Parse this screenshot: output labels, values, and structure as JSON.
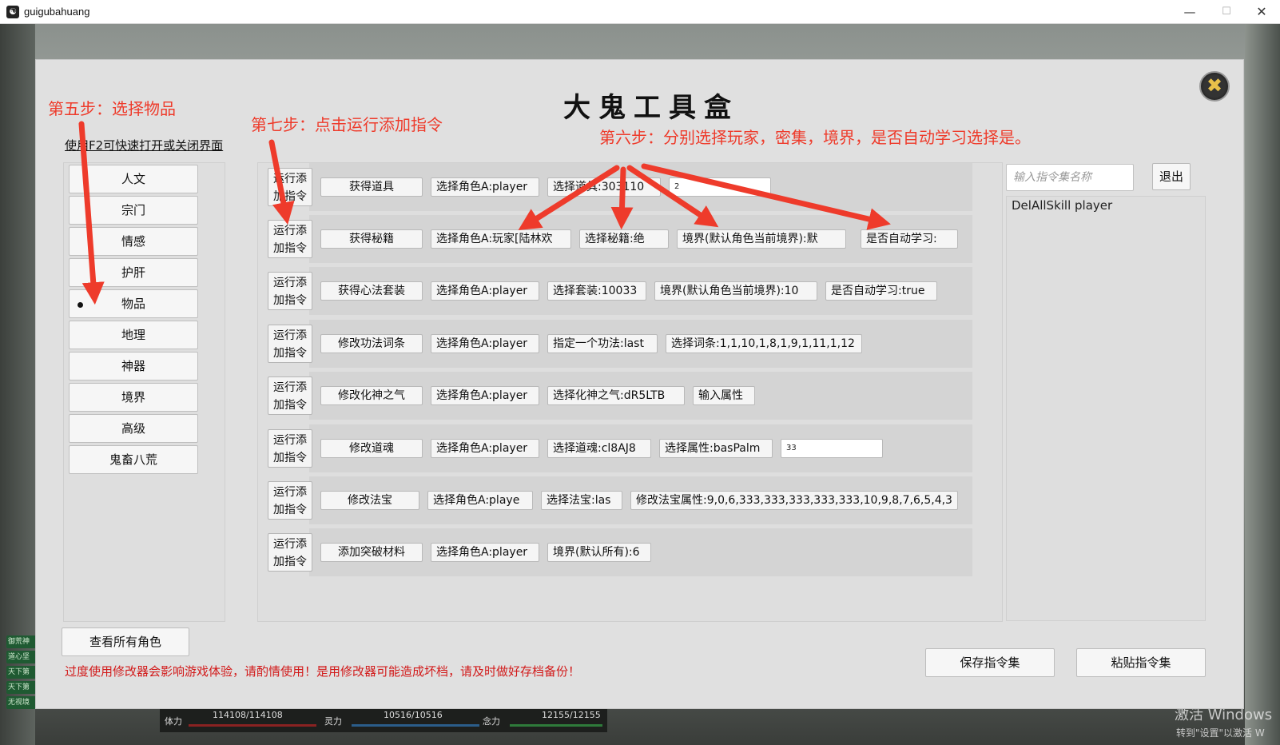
{
  "window": {
    "title": "guigubahuang",
    "minimize": "—",
    "maximize": "☐",
    "close": "✕"
  },
  "panel": {
    "title": "大鬼工具盒",
    "close_icon": "✖",
    "hint": "使用F2可快速打开或关闭界面"
  },
  "categories": [
    {
      "label": "人文",
      "selected": false
    },
    {
      "label": "宗门",
      "selected": false
    },
    {
      "label": "情感",
      "selected": false
    },
    {
      "label": "护肝",
      "selected": false
    },
    {
      "label": "物品",
      "selected": true
    },
    {
      "label": "地理",
      "selected": false
    },
    {
      "label": "神器",
      "selected": false
    },
    {
      "label": "境界",
      "selected": false
    },
    {
      "label": "高级",
      "selected": false
    },
    {
      "label": "鬼畜八荒",
      "selected": false
    }
  ],
  "run_button": {
    "line1": "运行添",
    "line2": "加指令"
  },
  "commands": [
    {
      "name": "获得道具",
      "params": [
        "选择角色A:player",
        "选择道具:303110"
      ],
      "input": "2"
    },
    {
      "name": "获得秘籍",
      "params": [
        "选择角色A:玩家[陆林欢",
        "选择秘籍:绝",
        "境界(默认角色当前境界):默",
        "是否自动学习:"
      ]
    },
    {
      "name": "获得心法套装",
      "params": [
        "选择角色A:player",
        "选择套装:10033",
        "境界(默认角色当前境界):10",
        "是否自动学习:true"
      ]
    },
    {
      "name": "修改功法词条",
      "params": [
        "选择角色A:player",
        "指定一个功法:last",
        "选择词条:1,1,10,1,8,1,9,1,11,1,12"
      ]
    },
    {
      "name": "修改化神之气",
      "params": [
        "选择角色A:player",
        "选择化神之气:dR5LTB",
        "输入属性"
      ]
    },
    {
      "name": "修改道魂",
      "params": [
        "选择角色A:player",
        "选择道魂:cl8AJ8",
        "选择属性:basPalm"
      ],
      "input": "33"
    },
    {
      "name": "修改法宝",
      "params": [
        "选择角色A:playe",
        "选择法宝:las",
        "修改法宝属性:9,0,6,333,333,333,333,333,10,9,8,7,6,5,4,3"
      ]
    },
    {
      "name": "添加突破材料",
      "params": [
        "选择角色A:player",
        "境界(默认所有):6"
      ]
    }
  ],
  "command_set": {
    "placeholder": "输入指令集名称",
    "exit_label": "退出",
    "entries": [
      "DelAllSkill player"
    ]
  },
  "footer": {
    "view_all": "查看所有角色",
    "warning": "过度使用修改器会影响游戏体验，请酌情使用！是用修改器可能造成坏档，请及时做好存档备份！",
    "save": "保存指令集",
    "paste": "粘贴指令集"
  },
  "annotations": {
    "step5": "第五步：选择物品",
    "step7": "第七步：点击运行添加指令",
    "step6": "第六步：分别选择玩家，密集，境界，是否自动学习选择是。",
    "color": "#ee3b2b"
  },
  "hud": {
    "hp_label": "体力",
    "hp": "114108/114108",
    "mp_label": "灵力",
    "mp": "10516/10516",
    "mind_label": "念力",
    "mind": "12155/12155"
  },
  "side_tags": [
    "御荒神",
    "道心坚",
    "天下第",
    "天下第",
    "无视境"
  ],
  "os_watermark": {
    "line1": "激活 Windows",
    "line2": "转到\"设置\"以激活 W"
  }
}
